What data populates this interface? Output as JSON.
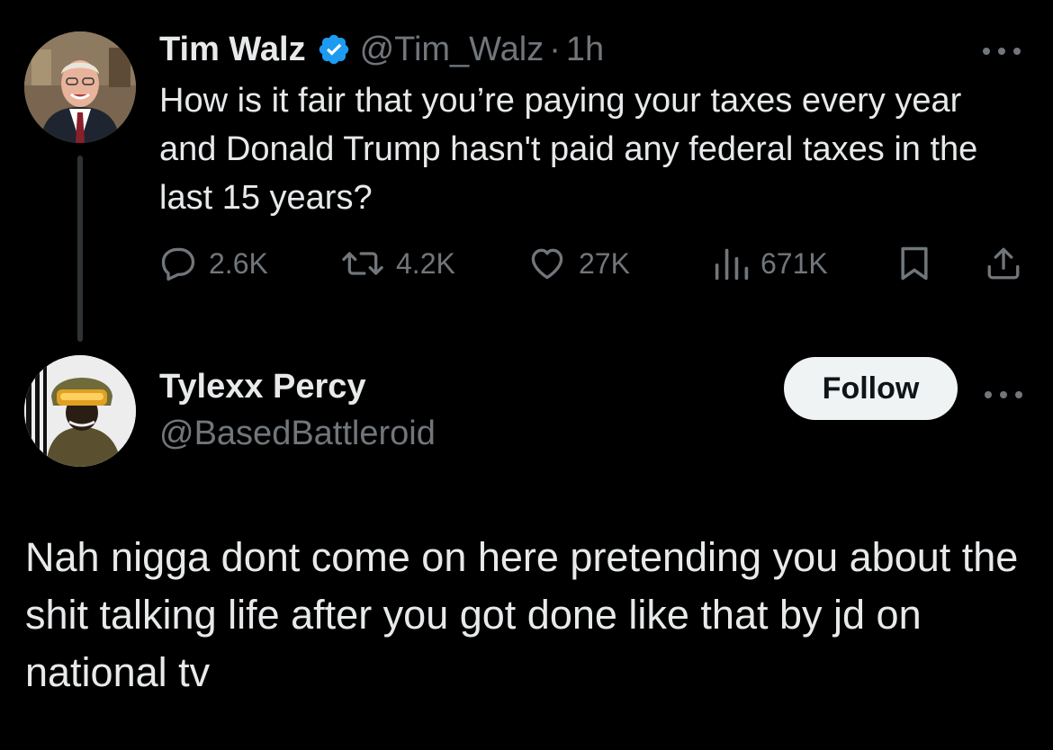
{
  "parent_tweet": {
    "display_name": "Tim Walz",
    "verified": true,
    "handle": "@Tim_Walz",
    "separator": "·",
    "time": "1h",
    "more_icon": "more-horizontal-icon",
    "text": "How is it fair that you’re paying your taxes every year and Donald Trump hasn't paid any federal taxes in the last 15 years?",
    "actions": {
      "replies": "2.6K",
      "reposts": "4.2K",
      "likes": "27K",
      "views": "671K"
    }
  },
  "reply": {
    "display_name": "Tylexx Percy",
    "handle": "@BasedBattleroid",
    "follow_label": "Follow",
    "more_icon": "more-horizontal-icon",
    "text": "Nah nigga dont come on here pretending you about the shit talking life after you got done like that by jd on national tv"
  },
  "colors": {
    "background": "#000000",
    "primary_text": "#e7e9ea",
    "secondary_text": "#71767b",
    "verified_blue": "#1d9bf0",
    "follow_button_bg": "#eff3f4"
  }
}
